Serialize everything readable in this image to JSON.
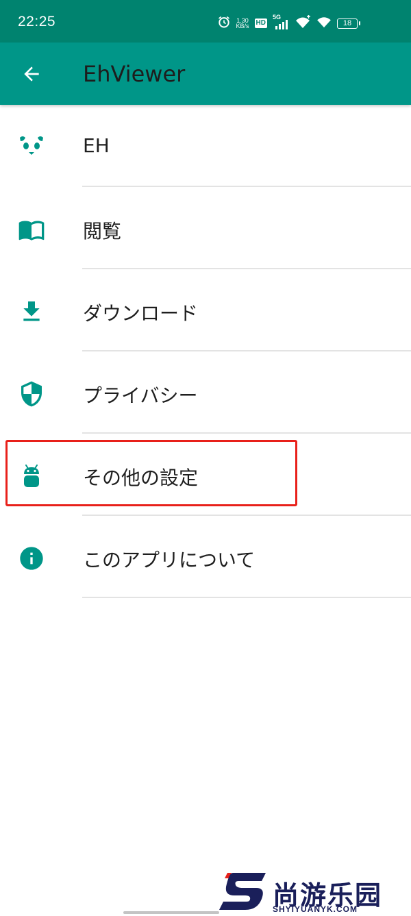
{
  "status_bar": {
    "time": "22:25",
    "net_speed_value": "1.30",
    "net_speed_unit": "KB/s",
    "hd_label": "HD",
    "net_type": "5G",
    "battery": "18",
    "icons": [
      "alarm-icon",
      "hd-icon",
      "signal-icon",
      "wifi-calling-icon",
      "wifi-icon",
      "battery-icon"
    ]
  },
  "app_bar": {
    "title": "EhViewer",
    "back_icon": "arrow-back-icon"
  },
  "settings": {
    "items": [
      {
        "label": "EH",
        "icon": "panda-icon"
      },
      {
        "label": "閲覧",
        "icon": "book-icon"
      },
      {
        "label": "ダウンロード",
        "icon": "download-icon"
      },
      {
        "label": "プライバシー",
        "icon": "shield-icon"
      },
      {
        "label": "その他の設定",
        "icon": "android-icon",
        "highlighted": true
      },
      {
        "label": "このアプリについて",
        "icon": "info-icon"
      }
    ]
  },
  "watermark": {
    "brand": "尚游乐园",
    "url": "SHYIYUANYK.COM"
  },
  "colors": {
    "status_bar": "#00836f",
    "app_bar": "#009688",
    "icon_teal": "#009688",
    "highlight": "#e8201a"
  }
}
